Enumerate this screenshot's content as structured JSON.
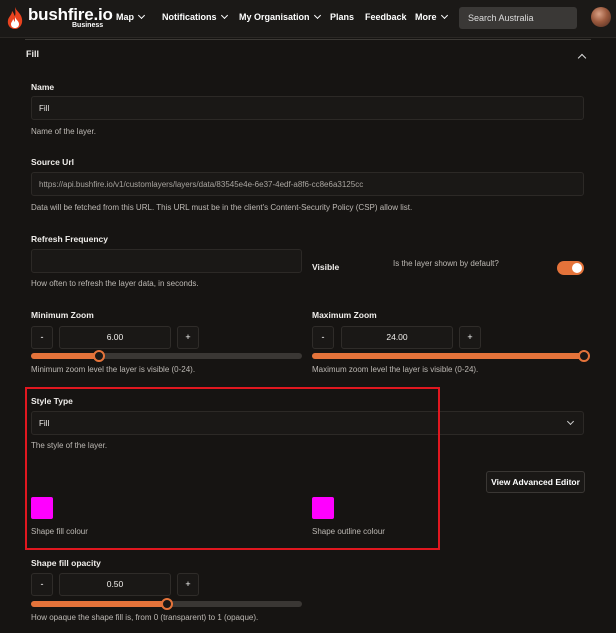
{
  "nav": {
    "brand": "bushfire.io",
    "brand_sub": "Business",
    "items": [
      {
        "label": "Map"
      },
      {
        "label": "Notifications"
      },
      {
        "label": "My Organisation"
      },
      {
        "label": "Plans"
      },
      {
        "label": "Feedback"
      },
      {
        "label": "More"
      }
    ],
    "search_placeholder": "Search Australia"
  },
  "section": {
    "title": "Fill"
  },
  "name": {
    "label": "Name",
    "value": "Fill",
    "help": "Name of the layer."
  },
  "source_url": {
    "label": "Source Url",
    "value": "https://api.bushfire.io/v1/customlayers/layers/data/83545e4e-6e37-4edf-a8f6-cc8e6a3125cc",
    "help": "Data will be fetched from this URL. This URL must be in the client's Content-Security Policy (CSP) allow list."
  },
  "refresh": {
    "label": "Refresh Frequency",
    "value": "",
    "help": "How often to refresh the layer data, in seconds."
  },
  "visible": {
    "label": "Visible",
    "help": "Is the layer shown by default?",
    "on": true
  },
  "min_zoom": {
    "label": "Minimum Zoom",
    "minus": "-",
    "value": "6.00",
    "plus": "+",
    "level": 0.25,
    "help": "Minimum zoom level the layer is visible (0-24)."
  },
  "max_zoom": {
    "label": "Maximum Zoom",
    "minus": "-",
    "value": "24.00",
    "plus": "+",
    "level": 1.0,
    "help": "Maximum zoom level the layer is visible (0-24)."
  },
  "style": {
    "label": "Style Type",
    "value": "Fill",
    "help": "The style of the layer.",
    "advanced_button": "View Advanced Editor",
    "fill_colour_label": "Shape fill colour",
    "outline_colour_label": "Shape outline colour",
    "fill_colour": "#ff00ff",
    "outline_colour": "#ff00ff"
  },
  "opacity": {
    "label": "Shape fill opacity",
    "minus": "-",
    "value": "0.50",
    "plus": "+",
    "level": 0.5,
    "help": "How opaque the shape fill is, from 0 (transparent) to 1 (opaque)."
  },
  "colors": {
    "accent": "#e4733a",
    "highlight": "#e0171f",
    "background": "#161412"
  }
}
